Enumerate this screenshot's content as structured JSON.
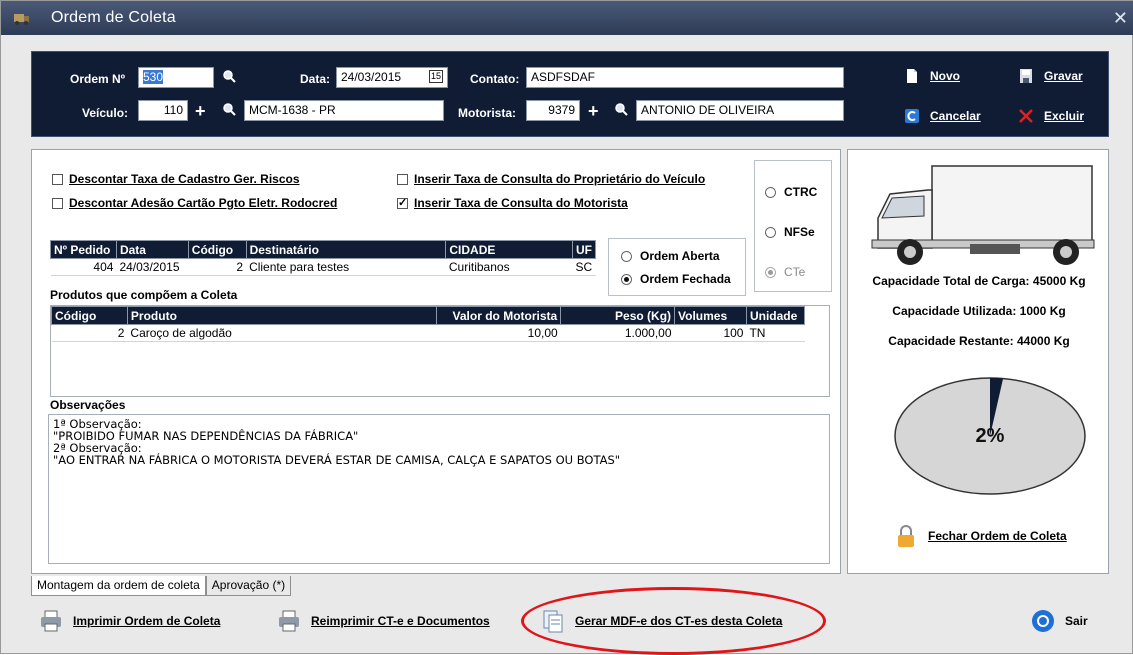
{
  "window": {
    "title": "Ordem de Coleta",
    "close": "✕"
  },
  "header": {
    "ordem_label": "Ordem Nº",
    "ordem_value": "530",
    "data_label": "Data:",
    "data_value": "24/03/2015",
    "calendar_glyph": "15",
    "contato_label": "Contato:",
    "contato_value": "ASDFSDAF",
    "veiculo_label": "Veículo:",
    "veiculo_value": "110",
    "veiculo_desc": "MCM-1638 - PR",
    "motorista_label": "Motorista:",
    "motorista_value": "9379",
    "motorista_desc": "ANTONIO DE OLIVEIRA",
    "plus": "+",
    "novo": "Novo",
    "gravar": "Gravar",
    "cancelar": "Cancelar",
    "excluir": "Excluir"
  },
  "options": {
    "descontar_taxa": "Descontar Taxa de Cadastro Ger. Riscos",
    "descontar_adesao": "Descontar Adesão Cartão Pgto Eletr. Rodocred",
    "inserir_proprietario": "Inserir Taxa de Consulta do Proprietário do Veículo",
    "inserir_motorista": "Inserir Taxa de Consulta do Motorista",
    "checked_mark": "✓"
  },
  "doc_type": {
    "ctrc": "CTRC",
    "nfse": "NFSe",
    "cte": "CTe"
  },
  "ordem_status": {
    "aberta": "Ordem Aberta",
    "fechada": "Ordem Fechada"
  },
  "pedidos": {
    "headers": [
      "Nº Pedido",
      "Data",
      "Código",
      "Destinatário",
      "CIDADE",
      "UF"
    ],
    "rows": [
      [
        "404",
        "24/03/2015",
        "2",
        "Cliente para testes",
        "Curitibanos",
        "SC"
      ]
    ]
  },
  "produtos": {
    "title": "Produtos que compõem a Coleta",
    "headers": [
      "Código",
      "Produto",
      "Valor do Motorista",
      "Peso (Kg)",
      "Volumes",
      "Unidade"
    ],
    "rows": [
      [
        "2",
        "Caroço de algodão",
        "10,00",
        "1.000,00",
        "100",
        "TN"
      ]
    ]
  },
  "observacoes": {
    "title": "Observações",
    "lines": [
      "1ª Observação:",
      "\"PROIBIDO FUMAR NAS DEPENDÊNCIAS DA FÁBRICA\"",
      "2ª Observação:",
      "\"AO ENTRAR NA FÁBRICA O MOTORISTA DEVERÁ ESTAR DE CAMISA, CALÇA E SAPATOS OU BOTAS\""
    ]
  },
  "capacity": {
    "total": "Capacidade Total de Carga: 45000 Kg",
    "utilizada": "Capacidade Utilizada: 1000 Kg",
    "restante": "Capacidade Restante: 44000 Kg",
    "percent_label": "2%",
    "used_fraction": 0.022,
    "fechar": "Fechar Ordem de Coleta"
  },
  "tabs": [
    "Montagem da ordem de coleta",
    "Aprovação (*)"
  ],
  "bottom": {
    "imprimir": "Imprimir Ordem de Coleta",
    "reimprimir": "Reimprimir CT-e e Documentos",
    "gerar": "Gerar MDF-e dos CT-es desta Coleta",
    "sair": "Sair"
  },
  "colors": {
    "header_bg": "#0f1c33",
    "title_bg": "#2e3b56",
    "highlight": "#e0151a"
  }
}
